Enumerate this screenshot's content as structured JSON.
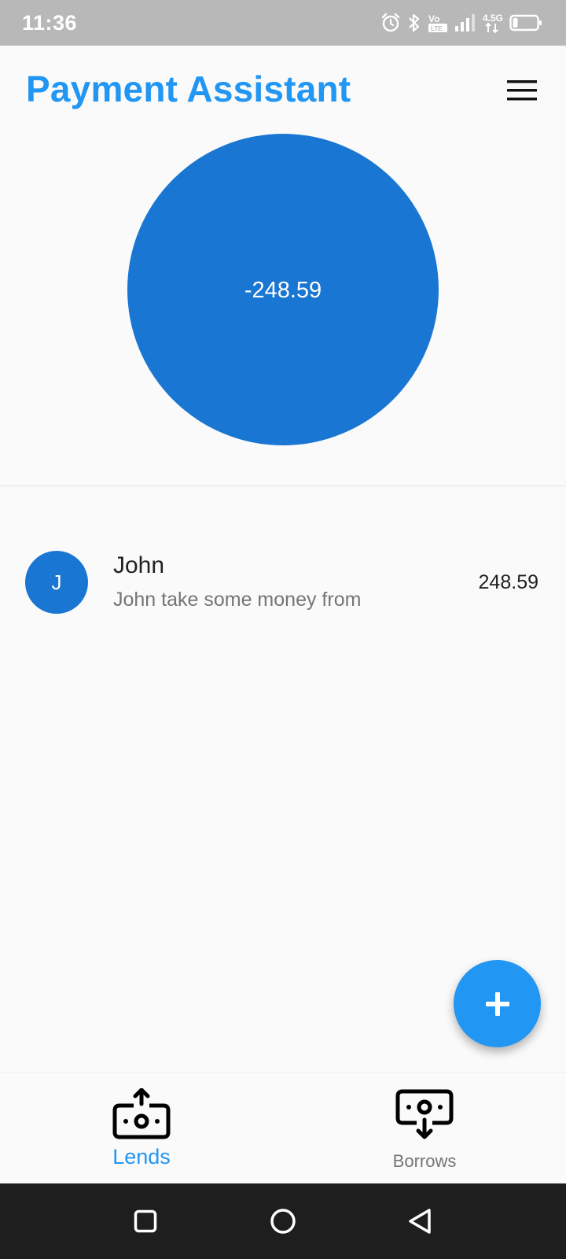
{
  "status_bar": {
    "time": "11:36",
    "icons": [
      "alarm-icon",
      "bluetooth-icon",
      "volte-icon",
      "signal-icon",
      "network-4g-icon",
      "battery-icon"
    ],
    "network_label": "4.5G",
    "volte_label": "LTE"
  },
  "app_bar": {
    "title": "Payment Assistant",
    "menu_icon": "hamburger-menu-icon"
  },
  "chart_data": {
    "type": "pie",
    "categories": [
      ""
    ],
    "values": [
      248.59
    ],
    "center_label": "-248.59",
    "colors": [
      "#1976d2"
    ]
  },
  "transactions": [
    {
      "avatar_letter": "J",
      "name": "John",
      "description": "John take some money from",
      "amount": "248.59"
    }
  ],
  "fab": {
    "icon": "plus-icon"
  },
  "bottom_nav": {
    "tabs": [
      {
        "label": "Lends",
        "icon": "money-upload-icon",
        "active": true
      },
      {
        "label": "Borrows",
        "icon": "money-download-icon",
        "active": false
      }
    ]
  },
  "system_nav": {
    "buttons": [
      "recents-square-icon",
      "home-circle-icon",
      "back-triangle-icon"
    ]
  },
  "colors": {
    "accent": "#2196f3",
    "chart_fill": "#1976d2",
    "status_bar": "#b8b8b8",
    "system_nav": "#1e1e1e"
  }
}
